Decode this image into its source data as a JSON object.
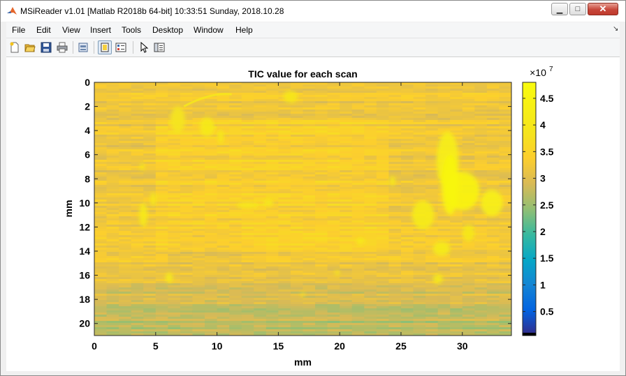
{
  "window": {
    "title": "MSiReader  v1.01  [Matlab R2018b 64-bit]  10:33:51 Sunday, 2018.10.28",
    "minimize_glyph": "▁",
    "maximize_glyph": "□",
    "close_glyph": "✕"
  },
  "menu": {
    "items": [
      "File",
      "Edit",
      "View",
      "Insert",
      "Tools",
      "Desktop",
      "Window",
      "Help"
    ],
    "dock_glyph": "↘"
  },
  "toolbar": {
    "buttons": [
      {
        "name": "new-figure-icon"
      },
      {
        "name": "open-file-icon"
      },
      {
        "name": "save-icon"
      },
      {
        "name": "print-icon"
      },
      {
        "name": "print-preview-icon"
      },
      {
        "name": "hide-plot-tools-icon",
        "active": true
      },
      {
        "name": "show-plot-tools-icon"
      },
      {
        "name": "edit-plot-arrow-icon"
      },
      {
        "name": "property-inspector-icon"
      }
    ]
  },
  "chart_data": {
    "type": "heatmap",
    "title": "TIC value for each scan",
    "xlabel": "mm",
    "ylabel": "mm",
    "xlim": [
      0,
      34
    ],
    "ylim": [
      0,
      21
    ],
    "y_reversed": true,
    "xticks": [
      0,
      5,
      10,
      15,
      20,
      25,
      30
    ],
    "yticks": [
      0,
      2,
      4,
      6,
      8,
      10,
      12,
      14,
      16,
      18,
      20
    ],
    "colorbar": {
      "exponent_label": "×10",
      "exponent_power": "7",
      "ticks": [
        0.5,
        1,
        1.5,
        2,
        2.5,
        3,
        3.5,
        4,
        4.5
      ],
      "min": 0.05,
      "max": 4.8,
      "colormap": "parula"
    },
    "grid": false,
    "base_value": 3.2
  }
}
